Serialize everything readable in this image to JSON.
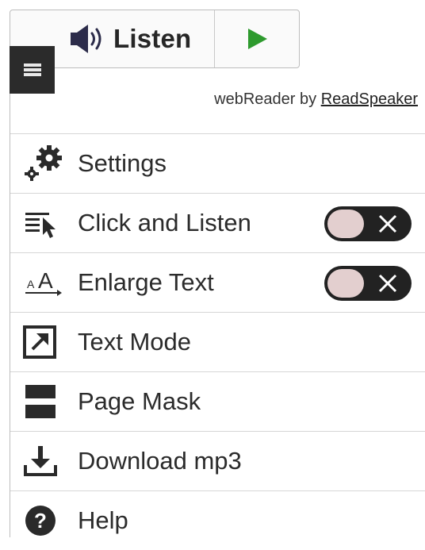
{
  "player": {
    "listen_label": "Listen",
    "speaker_icon": "speaker-icon",
    "play_icon": "play-icon",
    "play_color": "#2e9a2e"
  },
  "menu_toggle_icon": "menu-icon",
  "branding": {
    "prefix": "webReader by ",
    "link": "ReadSpeaker"
  },
  "menu": {
    "items": [
      {
        "label": "Settings",
        "icon": "gears-icon"
      },
      {
        "label": "Click and Listen",
        "icon": "click-listen-icon",
        "toggle": "off"
      },
      {
        "label": "Enlarge Text",
        "icon": "enlarge-text-icon",
        "toggle": "off"
      },
      {
        "label": "Text Mode",
        "icon": "text-mode-icon"
      },
      {
        "label": "Page Mask",
        "icon": "page-mask-icon"
      },
      {
        "label": "Download mp3",
        "icon": "download-icon"
      },
      {
        "label": "Help",
        "icon": "help-icon"
      }
    ]
  }
}
